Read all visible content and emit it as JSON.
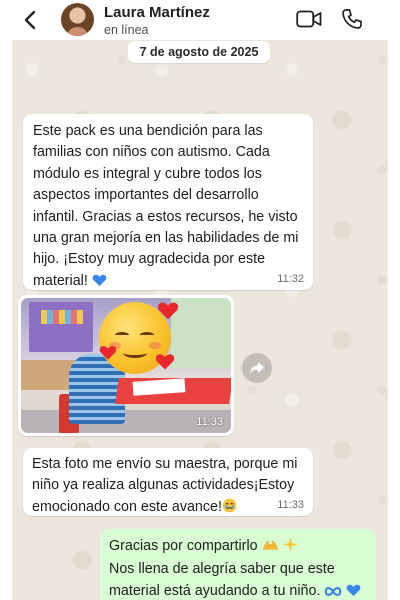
{
  "header": {
    "contact_name": "Laura Martínez",
    "status": "en línea",
    "icons": [
      "back-arrow-icon",
      "avatar",
      "video-call-icon",
      "phone-call-icon"
    ]
  },
  "chat": {
    "date_label": "7 de agosto de 2025",
    "messages": [
      {
        "direction": "incoming",
        "text": "Este pack es una bendición para las familias con niños con autismo. Cada módulo es integral y cubre todos los aspectos importantes del desarrollo infantil. Gracias a estos recursos, he visto una gran mejoría en las habilidades de mi hijo. ¡Estoy muy agradecida por este material!",
        "emoji": "blue-heart-icon",
        "time": "11:32"
      },
      {
        "direction": "incoming",
        "type": "photo",
        "time": "11:33"
      },
      {
        "direction": "incoming",
        "text": "Esta foto me envío su maestra, porque mi niño ya realiza algunas actividades¡Estoy emocionado con este avance!",
        "emoji": "crying-face-icon",
        "time": "11:33"
      },
      {
        "direction": "outgoing",
        "line1": "Gracias por compartirlo",
        "line1_emojis": [
          "hands-icon",
          "sparkles-icon"
        ],
        "line2": "Nos llena de alegría saber que este material está ayudando a tu niño.",
        "line2_emojis": [
          "infinity-icon",
          "blue-heart-icon"
        ]
      }
    ]
  },
  "colors": {
    "chat_background": "#ede6dc",
    "incoming_bubble": "#ffffff",
    "outgoing_bubble": "#d9fdd3",
    "accent_blue": "#2f7de1"
  }
}
